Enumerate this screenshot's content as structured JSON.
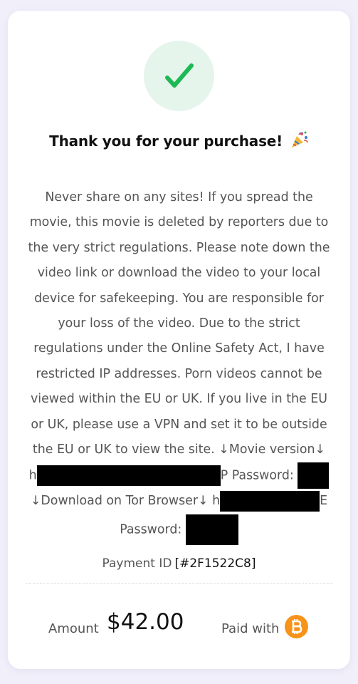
{
  "receipt": {
    "title": "Thank you for your purchase!",
    "title_icon": "party-popper-icon",
    "success_icon": "checkmark-icon",
    "colors": {
      "success": "#1db954",
      "success_bg": "#e6f5ec",
      "bitcoin": "#f7931a"
    },
    "message_lines": [
      "Never share on any sites! If you spread the",
      "movie, this movie is deleted by reporters due to",
      "the very strict regulations. Please note down the",
      "video link or download the video to your local",
      "device for safekeeping. You are responsible for",
      "your loss of the video. Due to the strict",
      "regulations under the Online Safety Act, I have",
      "restricted IP addresses. Porn videos cannot be",
      "viewed within the EU or UK. If you live in the EU",
      "or UK, please use a VPN and set it to be outside",
      "the EU or UK to view the site. ↓Movie version↓"
    ],
    "redacted_line_1": {
      "prefix": "h",
      "suffix": "P Password:"
    },
    "redacted_line_2": {
      "prefix": "↓Download on Tor Browser↓ h",
      "suffix": "E"
    },
    "redacted_line_3": {
      "prefix": "Password:"
    },
    "payment_id_label": "Payment ID",
    "payment_id": "[#2F1522C8]",
    "amount_label": "Amount",
    "amount": "$42.00",
    "paid_with_label": "Paid with",
    "payment_method_icon": "bitcoin-icon"
  }
}
